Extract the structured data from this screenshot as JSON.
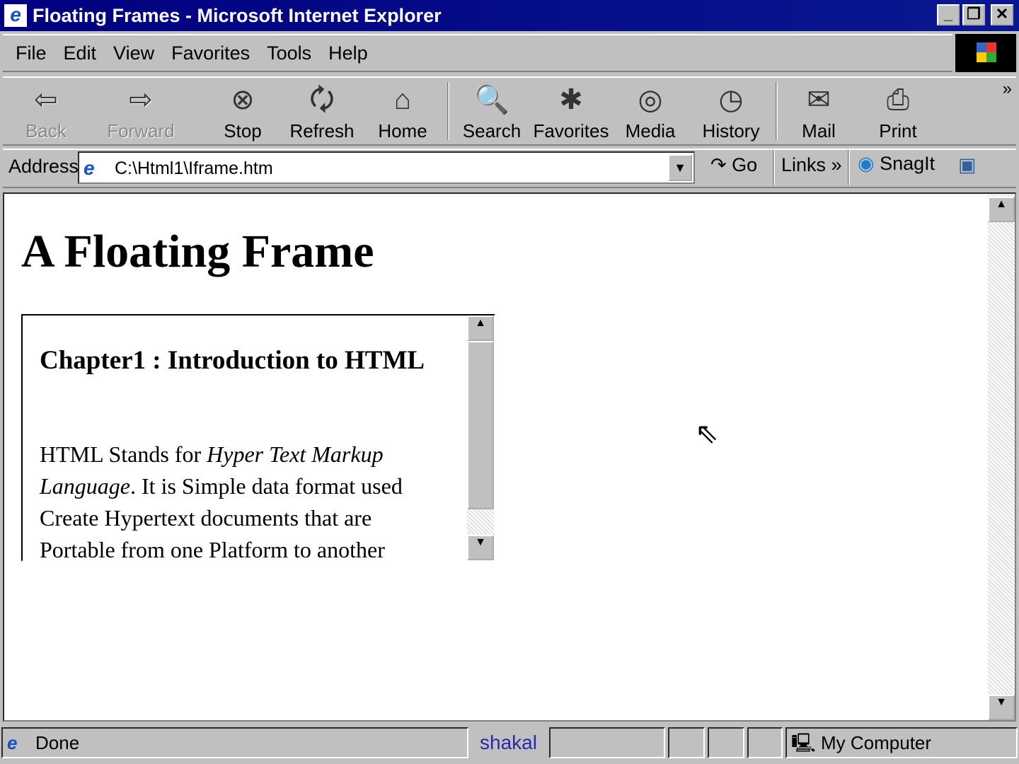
{
  "window": {
    "title": "Floating Frames - Microsoft Internet Explorer"
  },
  "menu": [
    "File",
    "Edit",
    "View",
    "Favorites",
    "Tools",
    "Help"
  ],
  "toolbar": [
    {
      "label": "Back",
      "icon": "⇦",
      "disabled": true
    },
    {
      "label": "Forward",
      "icon": "⇨",
      "disabled": true
    },
    {
      "label": "Stop",
      "icon": "⊗"
    },
    {
      "label": "Refresh",
      "icon": "🗘"
    },
    {
      "label": "Home",
      "icon": "⌂"
    },
    {
      "label": "Search",
      "icon": "🔍"
    },
    {
      "label": "Favorites",
      "icon": "✱"
    },
    {
      "label": "Media",
      "icon": "◎"
    },
    {
      "label": "History",
      "icon": "◷"
    },
    {
      "label": "Mail",
      "icon": "✉"
    },
    {
      "label": "Print",
      "icon": "⎙"
    }
  ],
  "address": {
    "label": "Address",
    "value": "C:\\Html1\\Iframe.htm",
    "go": "Go",
    "links": "Links",
    "snagit": "SnagIt"
  },
  "page": {
    "heading": "A Floating Frame",
    "iframe": {
      "heading": "Chapter1 : Introduction to HTML",
      "p1": "HTML Stands for ",
      "p1_em": "Hyper Text Markup Language",
      "p2": ". It is Simple data format used Create Hypertext documents that are Portable from one Platform to another"
    }
  },
  "status": {
    "text": "Done",
    "watermark": "shakal",
    "zone": "My Computer"
  }
}
